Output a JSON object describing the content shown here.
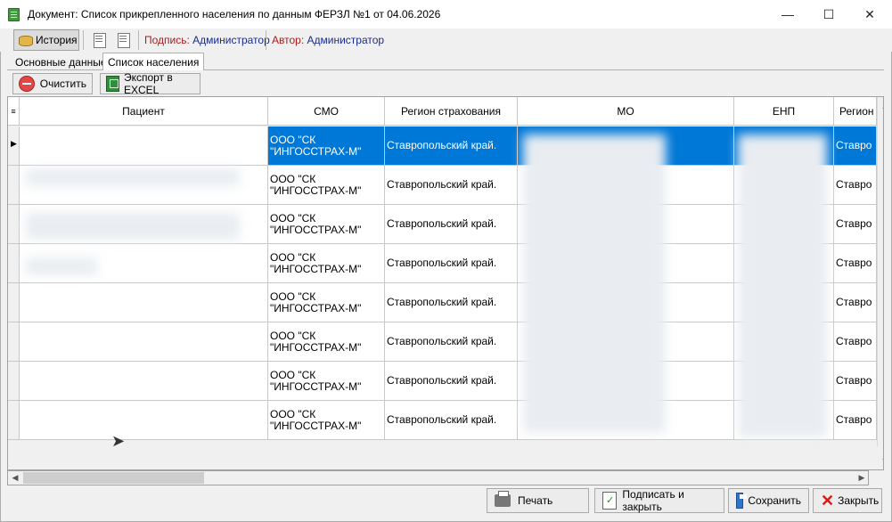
{
  "window": {
    "title": "Документ: Список прикрепленного населения по данным ФЕРЗЛ №1 от 04.06.2026",
    "minimize": "—",
    "maximize": "☐",
    "close": "✕"
  },
  "toolbar": {
    "history": "История",
    "sign_label": "Подпись:",
    "sign_value": "Администратор",
    "author_label": "Автор:",
    "author_value": "Администратор"
  },
  "tabs": [
    {
      "label": "Основные данные"
    },
    {
      "label": "Список населения"
    }
  ],
  "actions": {
    "clear": "Очистить",
    "export": "Экспорт в EXCEL"
  },
  "grid": {
    "columns": [
      "Пациент",
      "СМО",
      "Регион страхования",
      "МО",
      "ЕНП",
      "Регион"
    ],
    "rows": [
      {
        "smo": "ООО \"СК\n\"ИНГОССТРАХ-М\"",
        "region": "Ставропольский край.",
        "region2": "Ставро"
      },
      {
        "smo": "ООО \"СК\n\"ИНГОССТРАХ-М\"",
        "region": "Ставропольский край.",
        "region2": "Ставро"
      },
      {
        "smo": "ООО \"СК\n\"ИНГОССТРАХ-М\"",
        "region": "Ставропольский край.",
        "region2": "Ставро"
      },
      {
        "smo": "ООО \"СК\n\"ИНГОССТРАХ-М\"",
        "region": "Ставропольский край.",
        "region2": "Ставро"
      },
      {
        "smo": "ООО \"СК\n\"ИНГОССТРАХ-М\"",
        "region": "Ставропольский край.",
        "region2": "Ставро"
      },
      {
        "smo": "ООО \"СК\n\"ИНГОССТРАХ-М\"",
        "region": "Ставропольский край.",
        "region2": "Ставро"
      },
      {
        "smo": "ООО \"СК\n\"ИНГОССТРАХ-М\"",
        "region": "Ставропольский край.",
        "region2": "Ставро"
      },
      {
        "smo": "ООО \"СК\n\"ИНГОССТРАХ-М\"",
        "region": "Ставропольский край.",
        "region2": "Ставро"
      }
    ]
  },
  "buttons": {
    "print": "Печать",
    "sign_close": "Подписать и закрыть",
    "save": "Сохранить",
    "close": "Закрыть"
  }
}
